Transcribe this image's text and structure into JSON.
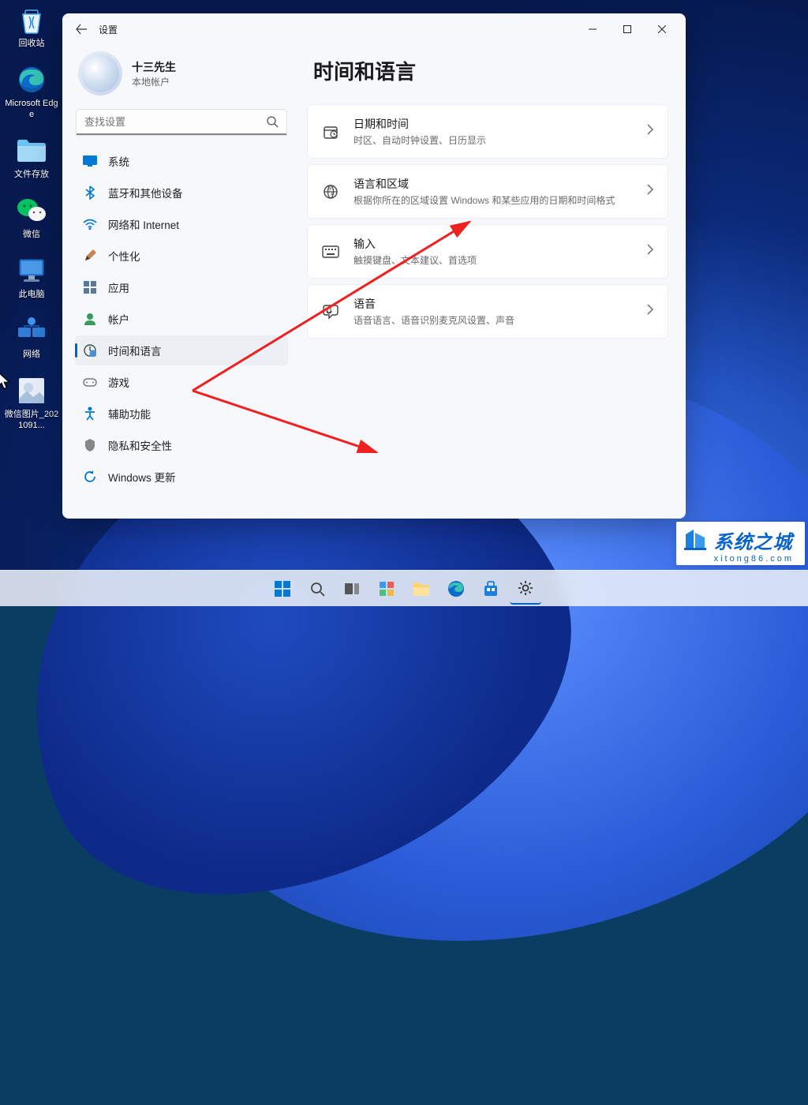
{
  "desktop": {
    "icons": [
      {
        "name": "recycle-bin",
        "label": "回收站"
      },
      {
        "name": "edge",
        "label": "Microsoft Edge"
      },
      {
        "name": "folder",
        "label": "文件存放"
      },
      {
        "name": "wechat",
        "label": "微信"
      },
      {
        "name": "thispc",
        "label": "此电脑"
      },
      {
        "name": "network",
        "label": "网络"
      },
      {
        "name": "image-file",
        "label": "微信图片_2021091..."
      }
    ]
  },
  "window": {
    "app_title": "设置",
    "profile": {
      "name": "十三先生",
      "subtitle": "本地帐户"
    },
    "search_placeholder": "查找设置",
    "nav": [
      {
        "key": "system",
        "label": "系统"
      },
      {
        "key": "bluetooth",
        "label": "蓝牙和其他设备"
      },
      {
        "key": "network",
        "label": "网络和 Internet"
      },
      {
        "key": "personalization",
        "label": "个性化"
      },
      {
        "key": "apps",
        "label": "应用"
      },
      {
        "key": "accounts",
        "label": "帐户"
      },
      {
        "key": "time-language",
        "label": "时间和语言",
        "active": true
      },
      {
        "key": "gaming",
        "label": "游戏"
      },
      {
        "key": "accessibility",
        "label": "辅助功能"
      },
      {
        "key": "privacy",
        "label": "隐私和安全性"
      },
      {
        "key": "update",
        "label": "Windows 更新"
      }
    ],
    "page_title": "时间和语言",
    "cards": [
      {
        "key": "datetime",
        "title": "日期和时间",
        "desc": "时区、自动时钟设置、日历显示"
      },
      {
        "key": "language-region",
        "title": "语言和区域",
        "desc": "根据你所在的区域设置 Windows 和某些应用的日期和时间格式"
      },
      {
        "key": "typing",
        "title": "输入",
        "desc": "触摸键盘、文本建议、首选项"
      },
      {
        "key": "speech",
        "title": "语音",
        "desc": "语音语言、语音识别麦克风设置、声音"
      }
    ]
  },
  "watermark": {
    "text": "系统之城",
    "url": "xitong86.com"
  }
}
